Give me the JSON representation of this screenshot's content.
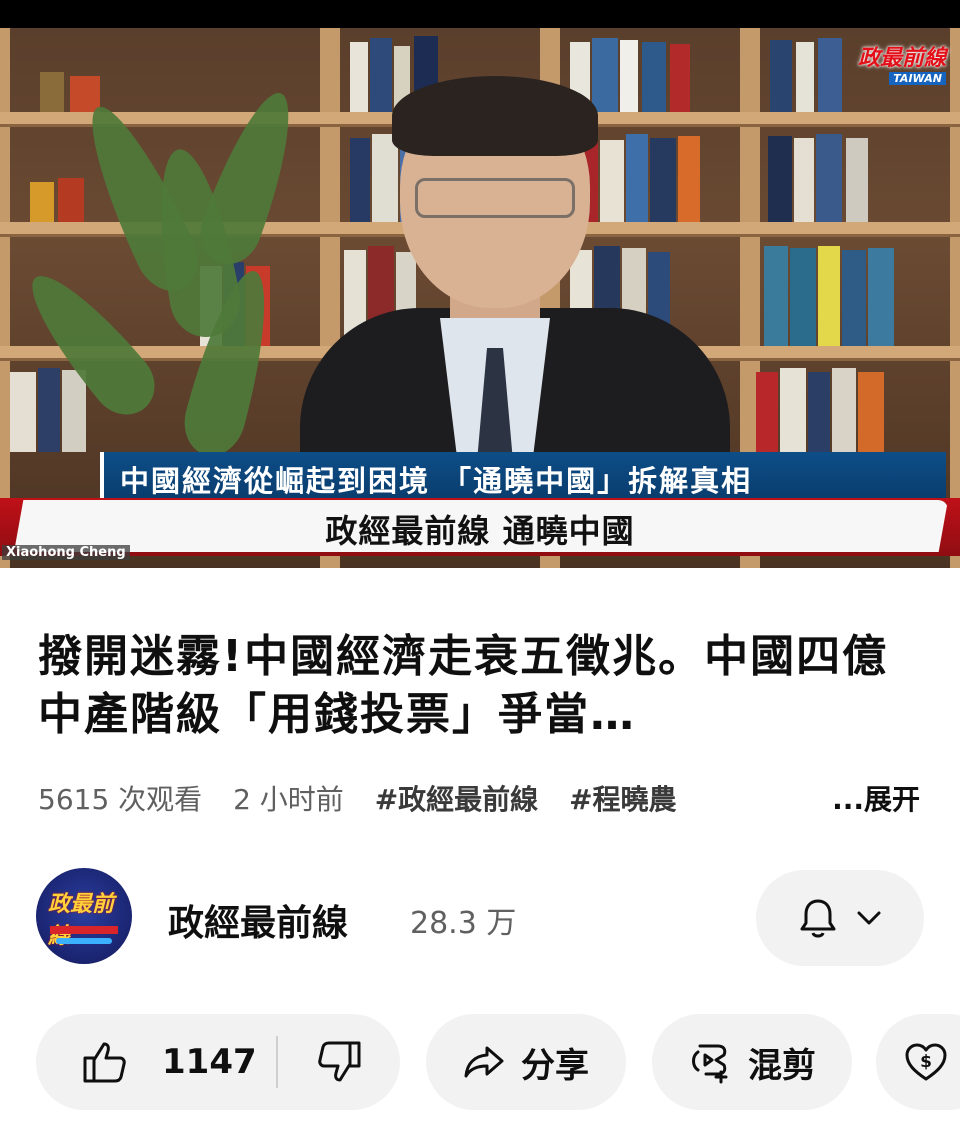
{
  "video": {
    "lower_third": "中國經濟從崛起到困境 「通曉中國」拆解真相",
    "banner": "政經最前線 通曉中國",
    "presenter": "Xiaohong Cheng",
    "logo_top": "政最前線",
    "logo_bottom": "TAIWAN"
  },
  "title": "撥開迷霧!中國經濟走衰五徵兆。中國四億中產階級「用錢投票」爭當…",
  "meta": {
    "views": "5615 次观看",
    "time": "2 小时前",
    "tags": [
      "#政經最前線",
      "#程曉農"
    ],
    "expand": "...展开"
  },
  "channel": {
    "name": "政經最前線",
    "subscribers": "28.3 万",
    "avatar_text": "政最前線"
  },
  "actions": {
    "like_count": "1147",
    "share": "分享",
    "remix": "混剪"
  },
  "icons": {
    "like": "thumbs-up-icon",
    "dislike": "thumbs-down-icon",
    "share": "share-icon",
    "remix": "remix-icon",
    "thanks": "thanks-icon",
    "bell": "bell-icon",
    "chevron": "chevron-down-icon"
  },
  "colors": {
    "banner_red": "#c01018",
    "banner_blue": "#0d4e88",
    "pill_bg": "#f2f2f2",
    "meta_gray": "#606060"
  }
}
